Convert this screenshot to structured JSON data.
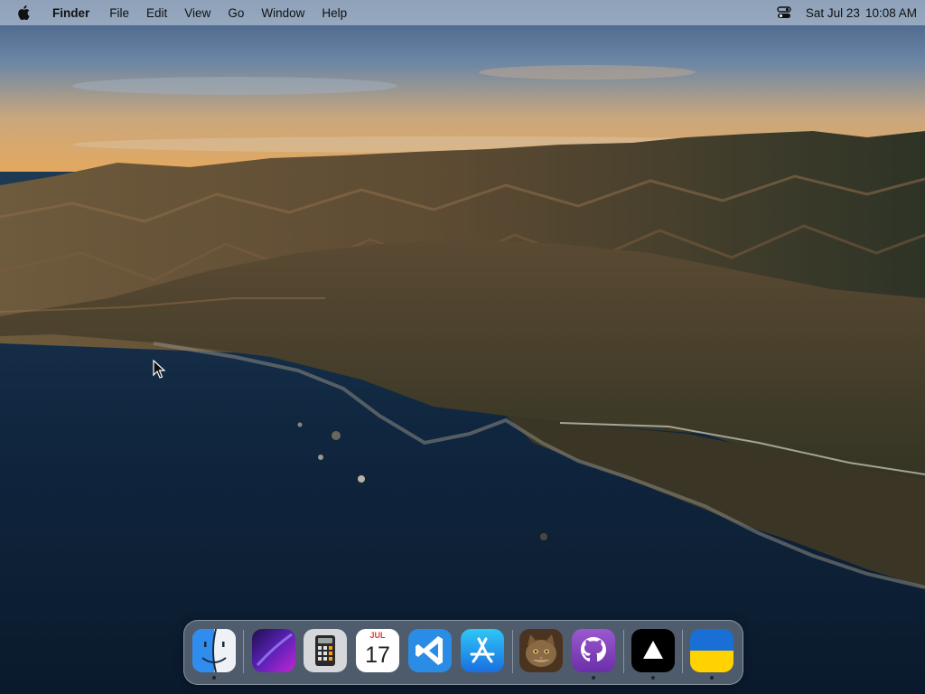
{
  "menubar": {
    "apple_icon": "apple-logo-icon",
    "app_name": "Finder",
    "items": [
      "File",
      "Edit",
      "View",
      "Go",
      "Window",
      "Help"
    ],
    "control_center_icon": "control-center-icon",
    "date": "Sat Jul 23",
    "time": "10:08 AM"
  },
  "calendar": {
    "month": "JUL",
    "day": "17"
  },
  "dock": {
    "apps": [
      {
        "name": "finder-icon",
        "running": true
      },
      {
        "name": "launchpad-icon",
        "running": false
      },
      {
        "name": "calculator-icon",
        "running": false
      },
      {
        "name": "calendar-icon",
        "running": false
      },
      {
        "name": "vscode-icon",
        "running": false
      },
      {
        "name": "app-store-icon",
        "running": false
      },
      {
        "name": "cat-photo-icon",
        "running": false
      },
      {
        "name": "github-desktop-icon",
        "running": true
      },
      {
        "name": "triangle-app-icon",
        "running": true
      },
      {
        "name": "ukraine-flag-icon",
        "running": true
      }
    ]
  },
  "colors": {
    "menubar_bg": "#d2dce8",
    "sea": "#0c2036",
    "sky_top": "#4e6d94",
    "sunset": "#f0b15a",
    "ukraine_blue": "#1a6fd6",
    "ukraine_yellow": "#ffd200"
  }
}
